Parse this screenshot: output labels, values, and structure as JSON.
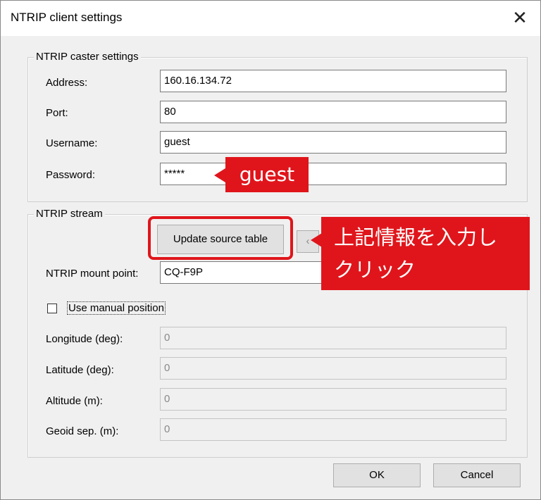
{
  "window": {
    "title": "NTRIP client settings",
    "close_glyph": "✕"
  },
  "caster": {
    "group_label": "NTRIP caster settings",
    "address_label": "Address:",
    "address_value": "160.16.134.72",
    "port_label": "Port:",
    "port_value": "80",
    "username_label": "Username:",
    "username_value": "guest",
    "password_label": "Password:",
    "password_value": "*****"
  },
  "stream": {
    "group_label": "NTRIP stream",
    "update_button_label": "Update source table",
    "mount_label": "NTRIP mount point:",
    "mount_value": "CQ-F9P",
    "manual_position_label": "Use manual position",
    "manual_position_checked": false,
    "longitude_label": "Longitude (deg):",
    "longitude_value": "0",
    "latitude_label": "Latitude (deg):",
    "latitude_value": "0",
    "altitude_label": "Altitude (m):",
    "altitude_value": "0",
    "geoid_label": "Geoid sep. (m):",
    "geoid_value": "0"
  },
  "footer": {
    "ok_label": "OK",
    "cancel_label": "Cancel"
  },
  "annotations": {
    "password_callout": "guest",
    "update_callout_line1": "上記情報を入力し",
    "update_callout_line2": "クリック",
    "accent_color": "#e0151b"
  }
}
